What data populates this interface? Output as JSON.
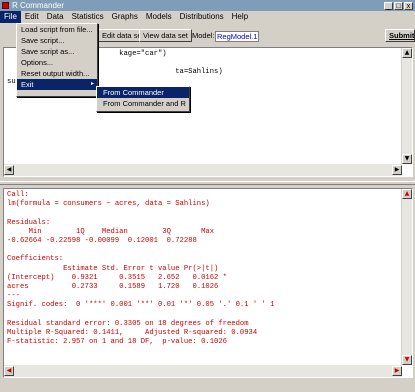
{
  "window": {
    "title": "R Commander",
    "controls": [
      "_",
      "□",
      "x"
    ]
  },
  "menubar": [
    "File",
    "Edit",
    "Data",
    "Statistics",
    "Graphs",
    "Models",
    "Distributions",
    "Help"
  ],
  "toolbar": {
    "edit_data_set": "Edit data set",
    "view_data_set": "View data set",
    "model_label": "Model:",
    "model_value": "RegModel.1",
    "submit": "Submit"
  },
  "file_menu": {
    "items": [
      "Load script from file...",
      "Save script...",
      "Save script as...",
      "Options...",
      "Reset output width...",
      "Exit"
    ]
  },
  "exit_submenu": {
    "items": [
      "From Commander",
      "From Commander and R"
    ]
  },
  "script_pane": {
    "text": "                          kage=\"car\")\n\n                                       ta=Sahlins)\nsummary(RegModel"
  },
  "output_pane": {
    "text": "Call:\nlm(formula = consumers ~ acres, data = Sahlins)\n\nResiduals:\n     Min        1Q    Median        3Q       Max\n-0.62664 -0.22598 -0.00099  0.12001  0.72288\n\nCoefficients:\n             Estimate Std. Error t value Pr(>|t|)\n(Intercept)    0.9321     0.3515   2.652   0.0162 *\nacres          0.2733     0.1589   1.720   0.1026\n---\nSignif. codes:  0 '***' 0.001 '**' 0.01 '*' 0.05 '.' 0.1 ' ' 1\n\nResidual standard error: 0.3305 on 18 degrees of freedom\nMultiple R-Squared: 0.1411,     Adjusted R-squared: 0.0934\nF-statistic: 2.957 on 1 and 18 DF,  p-value: 0.1026"
  },
  "icons": {
    "app": "r-logo-icon",
    "submenu_arrow": "▸",
    "scroll_up": "▲",
    "scroll_down": "▼",
    "scroll_left": "◀",
    "scroll_right": "▶"
  },
  "colors": {
    "output_text": "#cc0000",
    "menu_highlight": "#0a246a",
    "model_value": "#0000cc"
  }
}
